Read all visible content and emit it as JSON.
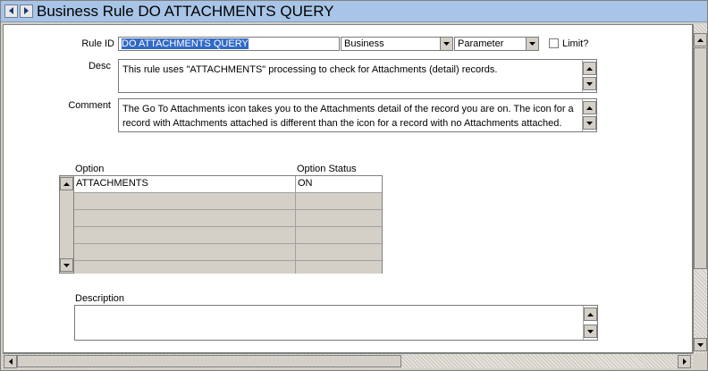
{
  "window": {
    "title": "Business Rule DO ATTACHMENTS QUERY"
  },
  "form": {
    "rule_id_label": "Rule ID",
    "rule_id_value": "DO ATTACHMENTS QUERY",
    "type_select": "Business",
    "kind_select": "Parameter",
    "limit_label": "Limit?",
    "desc_label": "Desc",
    "desc_value": "This rule uses \"ATTACHMENTS\" processing to check for Attachments (detail) records.",
    "comment_label": "Comment",
    "comment_value": "The Go To Attachments icon takes you to the Attachments detail of the record you are on.  The icon for a record with Attachments attached is different than the icon for a record with no Attachments attached. Both icons appear in the same location in the icon bar.",
    "description_label": "Description",
    "description_value": ""
  },
  "options_grid": {
    "col_option": "Option",
    "col_status": "Option Status",
    "rows": [
      {
        "option": "ATTACHMENTS",
        "status": "ON"
      },
      {
        "option": "",
        "status": ""
      },
      {
        "option": "",
        "status": ""
      },
      {
        "option": "",
        "status": ""
      },
      {
        "option": "",
        "status": ""
      },
      {
        "option": "",
        "status": ""
      }
    ]
  }
}
